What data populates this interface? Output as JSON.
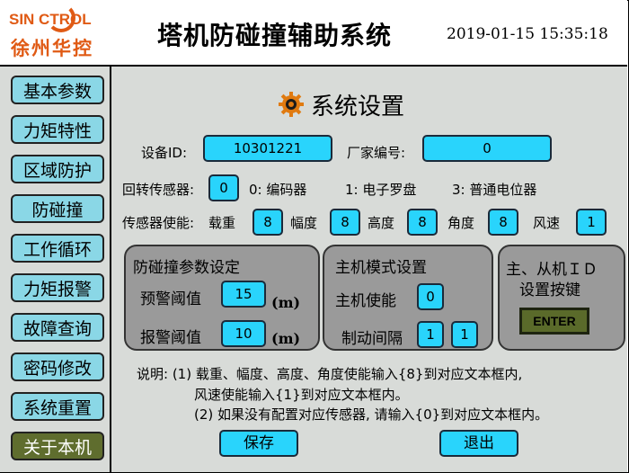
{
  "header": {
    "logo_top": "SIN CTROL",
    "logo_bottom": "徐州华控",
    "title": "塔机防碰撞辅助系统",
    "datetime": "2019-01-15 15:35:18"
  },
  "sidebar": {
    "items": [
      {
        "label": "基本参数"
      },
      {
        "label": "力矩特性"
      },
      {
        "label": "区域防护"
      },
      {
        "label": "防碰撞"
      },
      {
        "label": "工作循环"
      },
      {
        "label": "力矩报警"
      },
      {
        "label": "故障查询"
      },
      {
        "label": "密码修改"
      },
      {
        "label": "系统重置"
      },
      {
        "label": "关于本机"
      }
    ]
  },
  "page": {
    "title": "系统设置",
    "device_id_label": "设备ID:",
    "device_id_value": "10301221",
    "vendor_label": "厂家编号:",
    "vendor_value": "0",
    "rotation_label": "回转传感器:",
    "rotation_value": "0",
    "rotation_opt0": "0: 编码器",
    "rotation_opt1": "1: 电子罗盘",
    "rotation_opt3": "3: 普通电位器",
    "sensor_enable_label": "传感器使能:",
    "load_label": "载重",
    "load_value": "8",
    "amplitude_label": "幅度",
    "amplitude_value": "8",
    "height_label": "高度",
    "height_value": "8",
    "angle_label": "角度",
    "angle_value": "8",
    "wind_label": "风速",
    "wind_value": "1"
  },
  "anti_collision": {
    "title": "防碰撞参数设定",
    "warning_label": "预警阈值",
    "warning_value": "15",
    "alarm_label": "报警阈值",
    "alarm_value": "10",
    "unit": "(m)"
  },
  "host_mode": {
    "title": "主机模式设置",
    "enable_label": "主机使能",
    "enable_value": "0",
    "brake_label": "制动间隔",
    "brake_value1": "1",
    "brake_value2": "1"
  },
  "id_button": {
    "title_line1": "主、从机ＩＤ",
    "title_line2": "设置按键",
    "enter_label": "ENTER"
  },
  "notes": {
    "line1": "说明: (1) 载重、幅度、高度、角度使能输入{8}到对应文本框内,",
    "line2": "风速使能输入{1}到对应文本框内。",
    "line3": "(2) 如果没有配置对应传感器, 请输入{0}到对应文本框内。"
  },
  "actions": {
    "save_label": "保存",
    "exit_label": "退出"
  },
  "colors": {
    "accent_field": "#29d4fc",
    "nav_button": "#8ad7e6",
    "nav_active": "#5f6d2e",
    "panel": "#9a9a9a",
    "logo": "#e05a14"
  }
}
